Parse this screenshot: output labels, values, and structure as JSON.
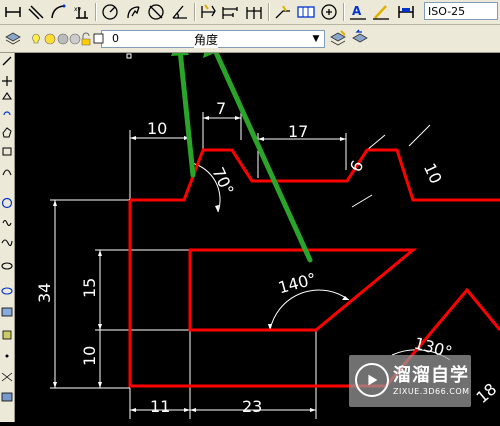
{
  "toolbar": {
    "dim_style": "ISO-25",
    "layer_name": "0",
    "layer_field_tail": "角度",
    "buttons": [
      "linear-dimension",
      "aligned-dimension",
      "arc-length-dimension",
      "ordinate-dimension",
      "radius-dimension",
      "jogged-dimension",
      "diameter-dimension",
      "angular-dimension",
      "quick-dimension",
      "baseline-dimension",
      "continue-dimension",
      "quick-leader",
      "tolerance",
      "center-mark",
      "dimension-edit",
      "dimension-text-edit",
      "dimension-update"
    ]
  },
  "drawing": {
    "dimensions": [
      "10",
      "7",
      "17",
      "70°",
      "6",
      "10",
      "34",
      "15",
      "10",
      "140°",
      "130°",
      "11",
      "23",
      "18"
    ],
    "colors": {
      "outline": "#ff0000",
      "dimension": "#ffffff",
      "arrow": "#2aa52a",
      "background": "#000000"
    }
  },
  "watermark": {
    "title": "溜溜自学",
    "url": "ZIXUE.3D66.COM"
  }
}
